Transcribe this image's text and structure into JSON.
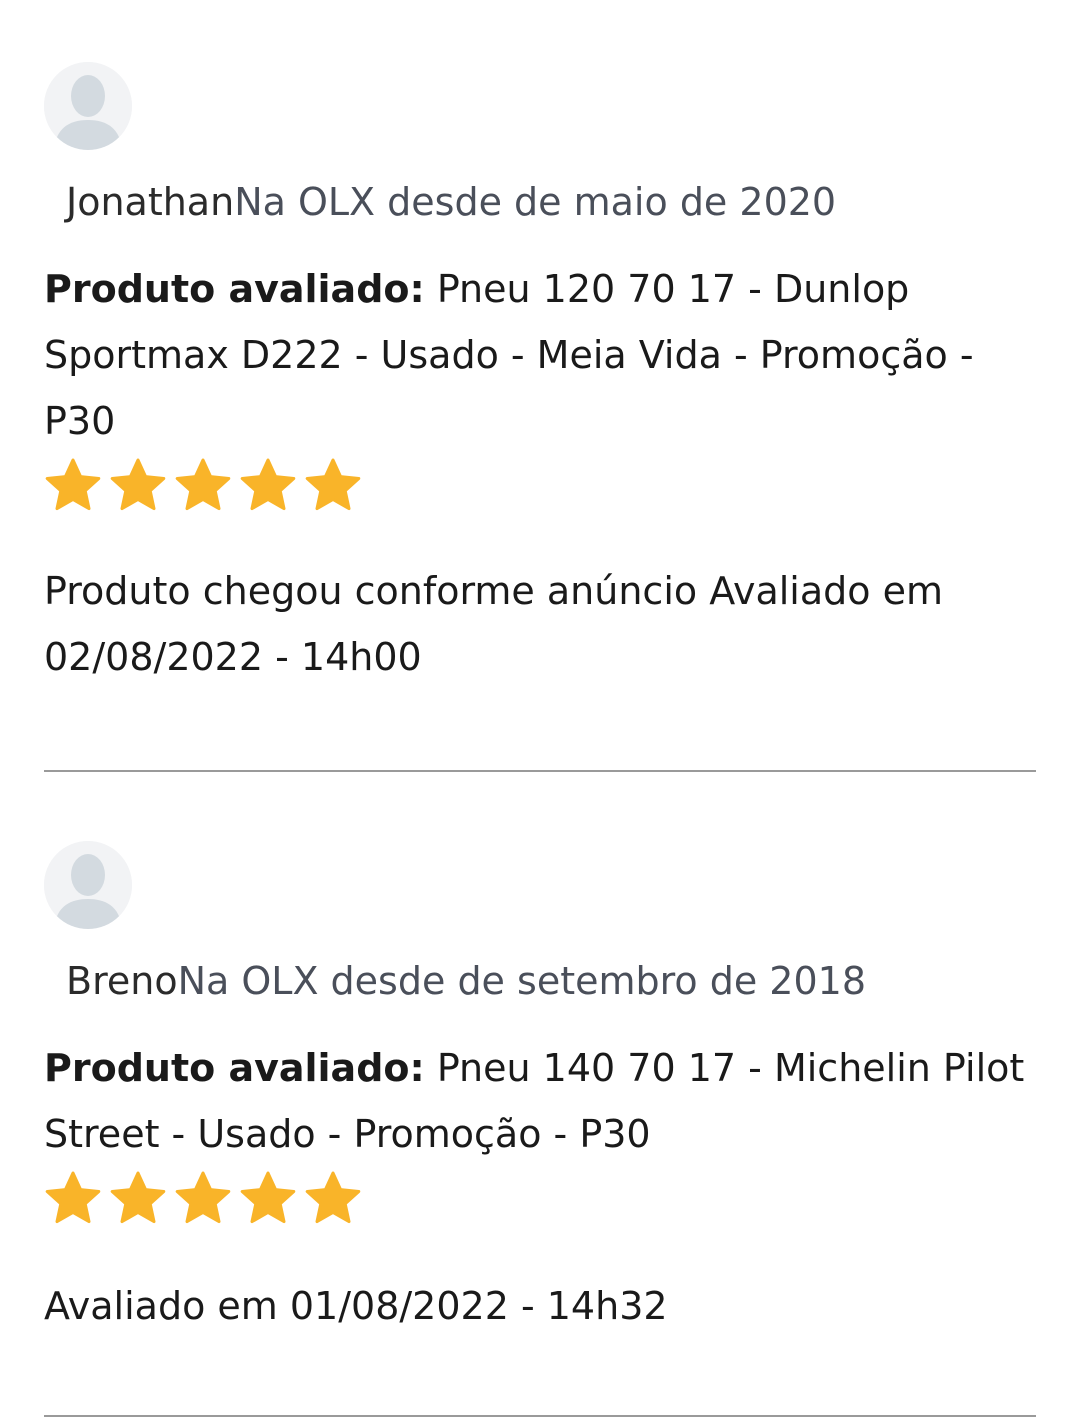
{
  "reviews": [
    {
      "user_name": "Jonathan",
      "member_since": "Na OLX desde de maio de 2020",
      "product_label": "Produto avaliado:",
      "product_name": "Pneu 120 70 17 - Dunlop Sportmax D222 - Usado - Meia Vida - Promoção - P30",
      "rating": 5,
      "rating_max": 5,
      "comment": "Produto chegou conforme anúncio Avaliado em 02/08/2022 - 14h00"
    },
    {
      "user_name": "Breno",
      "member_since": "Na OLX desde de setembro de 2018",
      "product_label": "Produto avaliado:",
      "product_name": "Pneu 140 70 17 - Michelin Pilot Street - Usado - Promoção - P30",
      "rating": 5,
      "rating_max": 5,
      "comment": "Avaliado em 01/08/2022 - 14h32"
    }
  ],
  "colors": {
    "star": "#F9B429",
    "divider": "#9A9A9A",
    "avatar_bg": "#F2F3F5",
    "avatar_figure": "#D3DAE0"
  },
  "icons": {
    "avatar": "user-avatar-icon",
    "star": "star-icon"
  }
}
